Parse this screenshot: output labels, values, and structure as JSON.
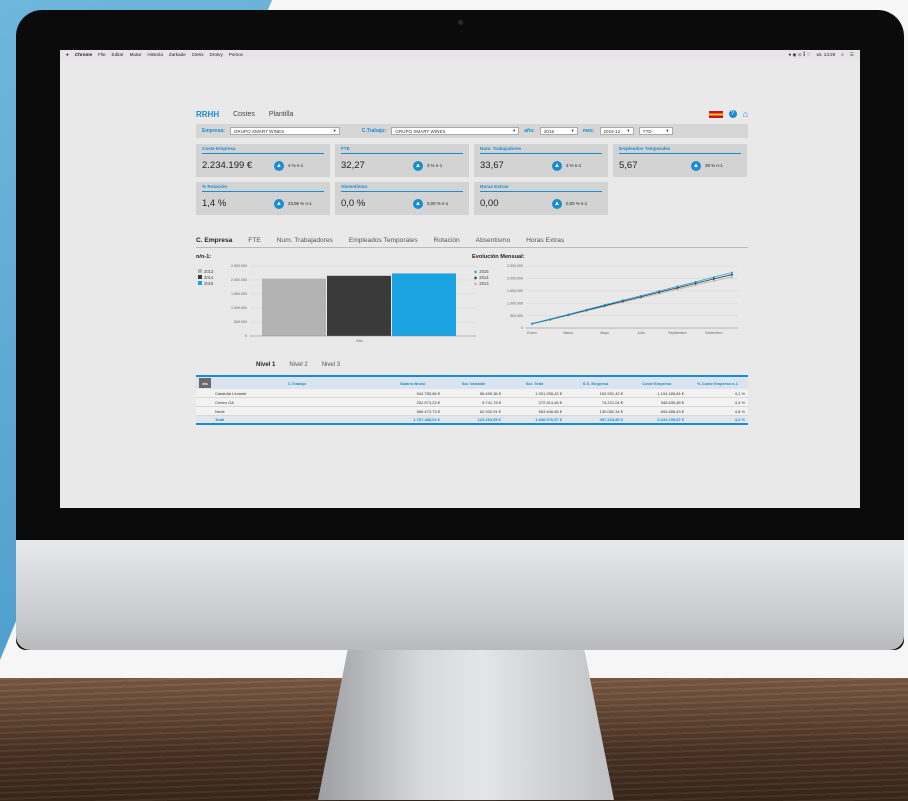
{
  "menubar": {
    "app": "Chrome",
    "items": [
      "File",
      "Editar",
      "Mutar",
      "Historia",
      "Zarkade",
      "Ctess",
      "Drotvy",
      "Pomoc"
    ],
    "clock": "wt. 14:29"
  },
  "app": {
    "brand": "RRHH",
    "nav": [
      "Costes",
      "Plantilla"
    ],
    "filters": {
      "empresa_label": "Empresa:",
      "empresa_value": "GRUPO SMART WINES",
      "ctrabajo_label": "C.Trabajo:",
      "ctrabajo_value": "GRUPO SMART WINES",
      "year_label": "año:",
      "year_value": "2015",
      "mes_label": "mes:",
      "mes_value": "2015-12",
      "period_value": "YTD"
    },
    "kpis": [
      {
        "title": "Coste Empresa",
        "value": "2.234.199 €",
        "delta": "4 % n-1"
      },
      {
        "title": "FTE",
        "value": "32,27",
        "delta": "3 % n-1"
      },
      {
        "title": "Num. Trabajadores",
        "value": "33,67",
        "delta": "3 % n-1"
      },
      {
        "title": "Empleados Temporales",
        "value": "5,67",
        "delta": "39 % n-1"
      },
      {
        "title": "% Rotación",
        "value": "1,4 %",
        "delta": "23,96 % n-1"
      },
      {
        "title": "Absentismo",
        "value": "0,0 %",
        "delta": "0,00 % n-1"
      },
      {
        "title": "Horas Extras",
        "value": "0,00",
        "delta": "0,00 % n-1"
      }
    ],
    "tabs": [
      "C. Empresa",
      "FTE",
      "Num. Trabajadores",
      "Empleados Temporales",
      "Rotación",
      "Absentismo",
      "Horas Extras"
    ],
    "subtabs": [
      "Nivel 1",
      "Nivel 2",
      "Nivel 3"
    ],
    "grid": {
      "headers": [
        "C.Trabajo",
        "Salario Bruto",
        "Sal. Variable",
        "Sal. Total",
        "S.S. Empresa",
        "Coste Empresa",
        "% Coste Empresa n-1"
      ],
      "rows": [
        [
          "Cataluña Levante",
          "944.755,86 €",
          "56.499,36 €",
          "1.001.255,42 €",
          "192.931,42 €",
          "1.194.185,84 €",
          "4,1 %"
        ],
        [
          "Centro GA",
          "252.573,23 €",
          "9.741,76 €",
          "272.314,46 €",
          "74.221,04 €",
          "346.535,48 €",
          "4,3 %"
        ],
        [
          "Norte",
          "566.473,73 €",
          "62.932,91 €",
          "563.406,65 €",
          "130.082,34 €",
          "693.488,43 €",
          "4,8 %"
        ]
      ],
      "total": [
        "Total",
        "1.767.488,04 €",
        "129.193,65 €",
        "1.836.976,57 €",
        "397.234,80 €",
        "2.234.199,87 €",
        "4,2 %"
      ]
    }
  },
  "chart_data": [
    {
      "type": "bar",
      "title": "n/n-1:",
      "categories": [
        "Año"
      ],
      "series": [
        {
          "name": "2013",
          "values": [
            2050000
          ],
          "color": "#b3b3b3"
        },
        {
          "name": "2014",
          "values": [
            2150000
          ],
          "color": "#3a3a3a"
        },
        {
          "name": "2015",
          "values": [
            2234199
          ],
          "color": "#1aa3e0"
        }
      ],
      "yticks": [
        "2.500.000",
        "2.000.000",
        "1.500.000",
        "1.000.000",
        "500.000",
        "0"
      ],
      "ylim": [
        0,
        2500000
      ]
    },
    {
      "type": "line",
      "title": "Evolución Mensual:",
      "x": [
        "Enero",
        "Febrero",
        "Marzo",
        "Abril",
        "Mayo",
        "Junio",
        "Julio",
        "Agosto",
        "Septiembre",
        "Octubre",
        "Noviembre",
        "Diciembre"
      ],
      "xticks": [
        "Enero",
        "Marzo",
        "Mayo",
        "Julio",
        "Septiembre",
        "Noviembre"
      ],
      "series": [
        {
          "name": "2015",
          "values": [
            180000,
            360000,
            550000,
            740000,
            930000,
            1120000,
            1300000,
            1490000,
            1680000,
            1860000,
            2050000,
            2234199
          ],
          "color": "#1aa3e0"
        },
        {
          "name": "2014",
          "values": [
            170000,
            345000,
            530000,
            715000,
            900000,
            1080000,
            1260000,
            1440000,
            1620000,
            1800000,
            1980000,
            2150000
          ],
          "color": "#333333"
        },
        {
          "name": "2013",
          "values": [
            165000,
            335000,
            510000,
            690000,
            865000,
            1040000,
            1215000,
            1385000,
            1560000,
            1730000,
            1900000,
            2050000
          ],
          "color": "#b3b3b3"
        }
      ],
      "yticks": [
        "2.500.000",
        "2.000.000",
        "1.500.000",
        "1.000.000",
        "500.000",
        "0"
      ],
      "ylim": [
        0,
        2500000
      ]
    }
  ]
}
